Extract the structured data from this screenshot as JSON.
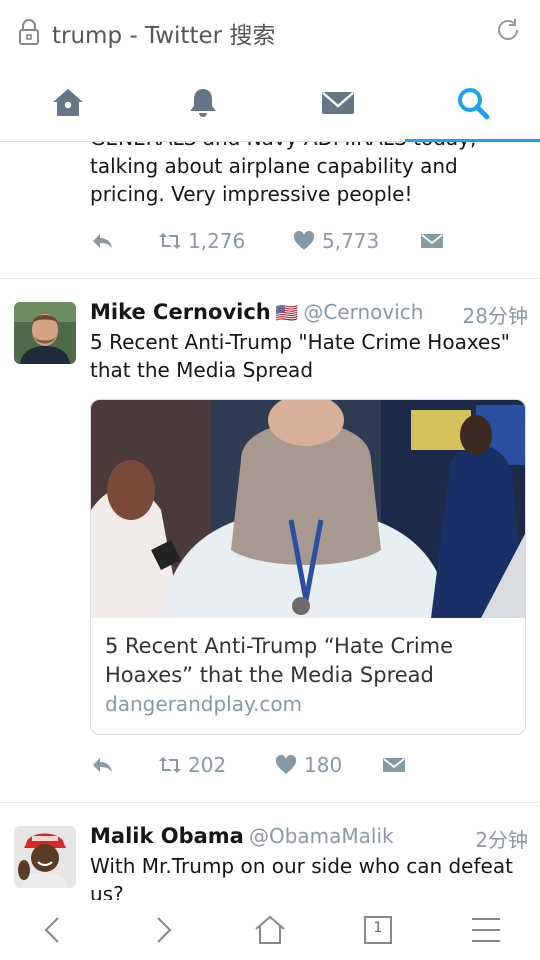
{
  "browser": {
    "title": "trump - Twitter 搜索",
    "tab_count": "1"
  },
  "nav": {
    "tabs": [
      "home",
      "notifications",
      "messages",
      "search"
    ],
    "active": "search",
    "accent": "#1da1f2",
    "icon_color": "#657786"
  },
  "tweet_prev": {
    "text_cut": "GENERALS and Navy ADMIRALS today,",
    "text": "talking about airplane capability and pricing. Very impressive people!",
    "retweets": "1,276",
    "likes": "5,773"
  },
  "tweet_cernovich": {
    "name": "Mike Cernovich",
    "flag": "🇺🇸",
    "handle": "@Cernovich",
    "time": "28分钟",
    "text": "5 Recent Anti-Trump \"Hate Crime Hoaxes\" that the Media Spread",
    "card": {
      "title": "5 Recent Anti-Trump “Hate Crime Hoaxes” that the Media Spread",
      "domain": "dangerandplay.com"
    },
    "retweets": "202",
    "likes": "180"
  },
  "tweet_malik": {
    "name": "Malik Obama",
    "handle": "@ObamaMalik",
    "time": "2分钟",
    "text": "With Mr.Trump on our side who can defeat us?"
  }
}
